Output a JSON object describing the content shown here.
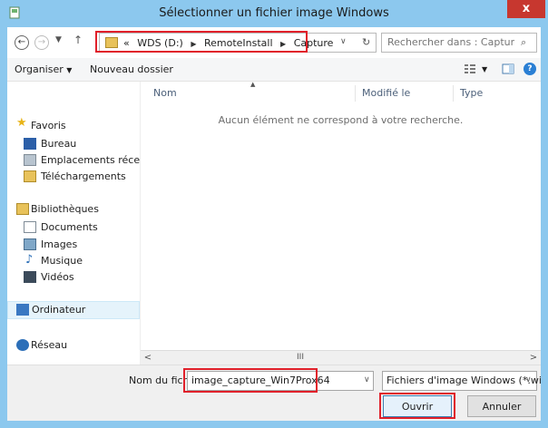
{
  "window": {
    "title": "Sélectionner un fichier image Windows",
    "close_label": "x"
  },
  "navigation": {
    "back_icon": "back-arrow-icon",
    "forward_icon": "forward-arrow-icon",
    "recent_icon": "chevron-down-icon",
    "up_icon": "up-arrow-icon",
    "address": {
      "overflow": "«",
      "crumbs": [
        "WDS (D:)",
        "RemoteInstall",
        "Capture"
      ],
      "separator": "▶"
    },
    "search_placeholder": "Rechercher dans : Capture"
  },
  "toolbar": {
    "organize_label": "Organiser",
    "new_folder_label": "Nouveau dossier"
  },
  "sidebar": {
    "items": [
      {
        "label": "Favoris"
      },
      {
        "label": "Bureau"
      },
      {
        "label": "Emplacements récents"
      },
      {
        "label": "Téléchargements"
      },
      {
        "label": "Bibliothèques"
      },
      {
        "label": "Documents"
      },
      {
        "label": "Images"
      },
      {
        "label": "Musique"
      },
      {
        "label": "Vidéos"
      },
      {
        "label": "Ordinateur"
      },
      {
        "label": "Réseau"
      }
    ]
  },
  "content": {
    "columns": [
      "Nom",
      "Modifié le",
      "Type"
    ],
    "empty_message": "Aucun élément ne correspond à votre recherche."
  },
  "scrollbar": {
    "left": "<",
    "thumb": "III",
    "right": ">"
  },
  "footer": {
    "filename_label": "Nom du fichier :",
    "filename_value": "image_capture_Win7Prox64",
    "filetype_value": "Fichiers d'image Windows (*.wi",
    "open_label": "Ouvrir",
    "cancel_label": "Annuler"
  },
  "colors": {
    "title_bar": "#8cc8ee",
    "close_button": "#c7372f",
    "highlight": "#e0202a",
    "folder": "#e8c25a"
  }
}
